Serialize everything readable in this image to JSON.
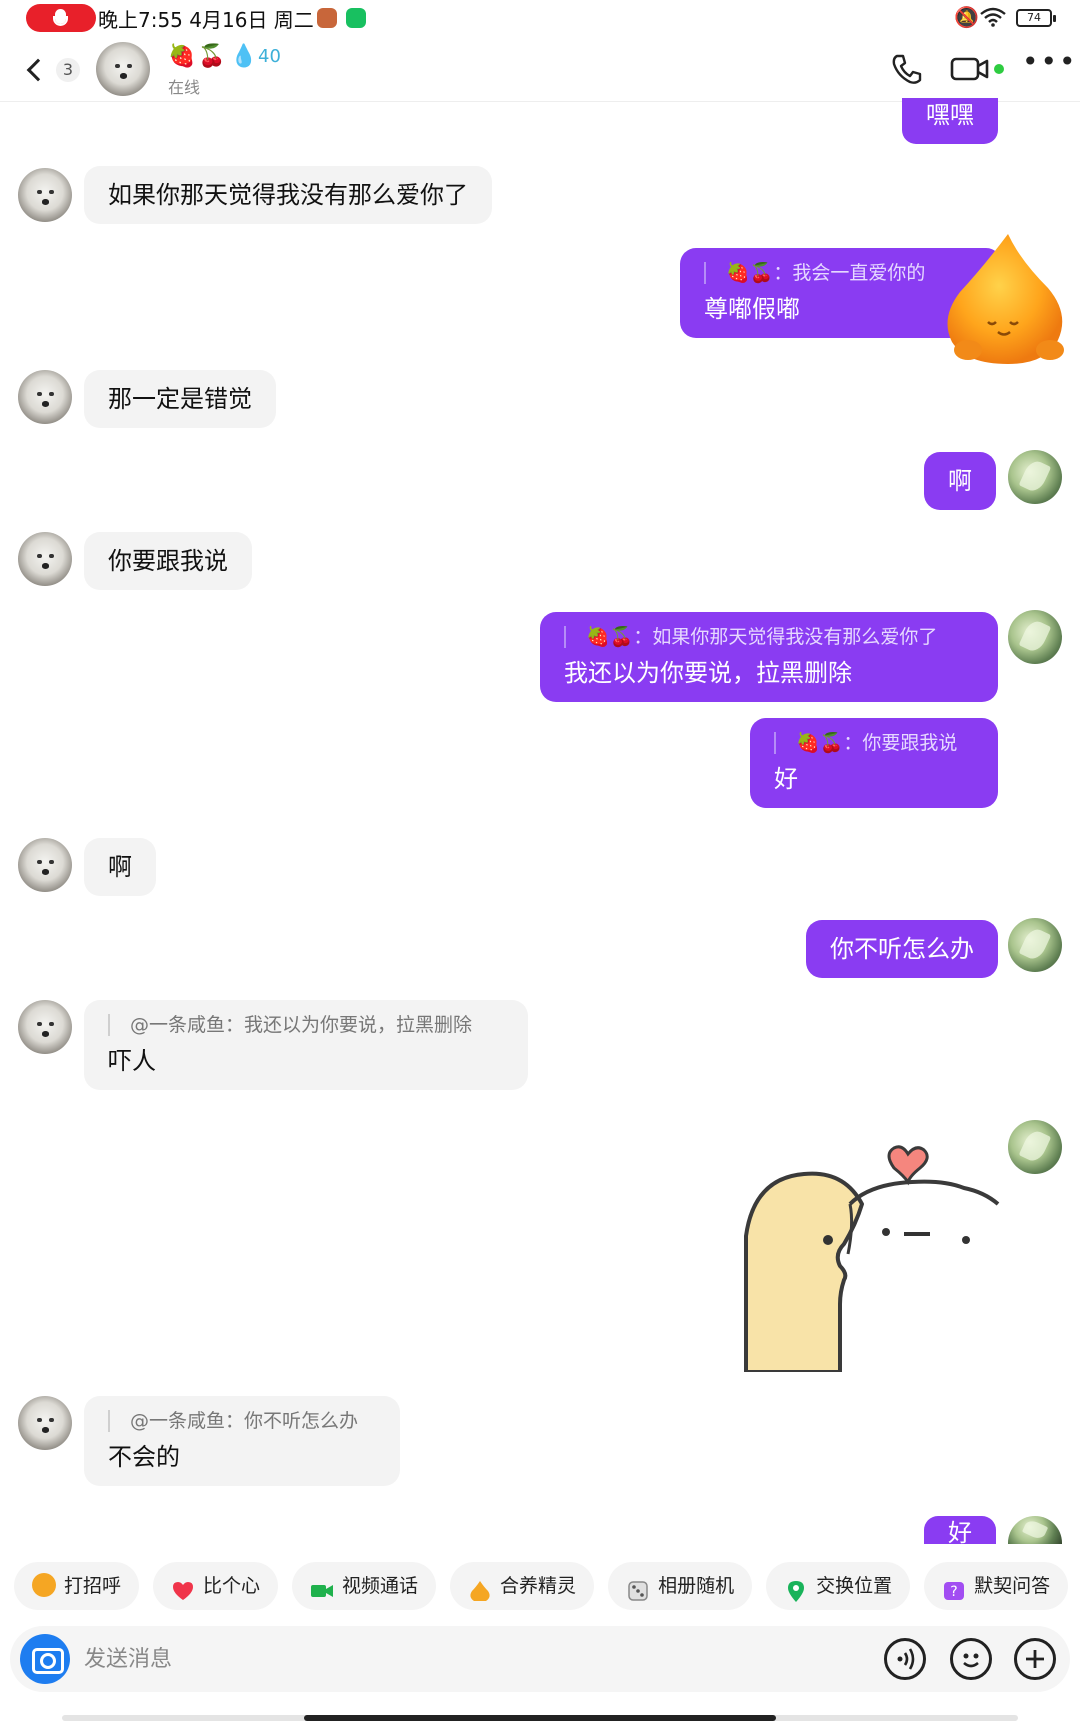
{
  "status_bar": {
    "time_date": "晚上7:55 4月16日 周二",
    "battery": "74"
  },
  "header": {
    "unread_count": "3",
    "emojis": [
      "🍓",
      "🍒",
      "💧"
    ],
    "flame_count": "40",
    "presence": "在线",
    "icons": [
      "back-icon",
      "phone-icon",
      "video-icon",
      "more-icon"
    ]
  },
  "messages": [
    {
      "side": "right",
      "text": "嘿嘿"
    },
    {
      "side": "left",
      "text": "如果你那天觉得我没有那么爱你了"
    },
    {
      "side": "right",
      "quote": "🍓🍒：我会一直爱你的",
      "text": "尊嘟假嘟"
    },
    {
      "side": "left",
      "text": "那一定是错觉"
    },
    {
      "side": "right",
      "text": "啊"
    },
    {
      "side": "left",
      "text": "你要跟我说"
    },
    {
      "side": "right",
      "quote": "🍓🍒：如果你那天觉得我没有那么爱你了",
      "text": "我还以为你要说，拉黑删除"
    },
    {
      "side": "right",
      "quote": "🍓🍒：你要跟我说",
      "text": "好"
    },
    {
      "side": "left",
      "text": "啊"
    },
    {
      "side": "right",
      "text": "你不听怎么办"
    },
    {
      "side": "left",
      "quote": "@一条咸鱼：我还以为你要说，拉黑删除",
      "text": "吓人"
    },
    {
      "side": "right",
      "type": "sticker"
    },
    {
      "side": "left",
      "quote": "@一条咸鱼：你不听怎么办",
      "text": "不会的"
    },
    {
      "side": "right",
      "text": "好"
    }
  ],
  "quick_actions": [
    {
      "label": "打招呼",
      "icon": "wave-hand-icon",
      "color": "#f5a623"
    },
    {
      "label": "比个心",
      "icon": "heart-icon",
      "color": "#f0344a"
    },
    {
      "label": "视频通话",
      "icon": "video-call-icon",
      "color": "#1fb14c"
    },
    {
      "label": "合养精灵",
      "icon": "sprite-icon",
      "color": "#f5a623"
    },
    {
      "label": "相册随机",
      "icon": "dice-icon",
      "color": "#888888"
    },
    {
      "label": "交换位置",
      "icon": "location-pin-icon",
      "color": "#19b35a"
    },
    {
      "label": "默契问答",
      "icon": "question-icon",
      "color": "#a24df2"
    }
  ],
  "input": {
    "placeholder": "发送消息"
  },
  "colors": {
    "outgoing_bubble": "#8a3cf2",
    "incoming_bubble": "#f3f3f3",
    "camera_button": "#1e7df0"
  }
}
